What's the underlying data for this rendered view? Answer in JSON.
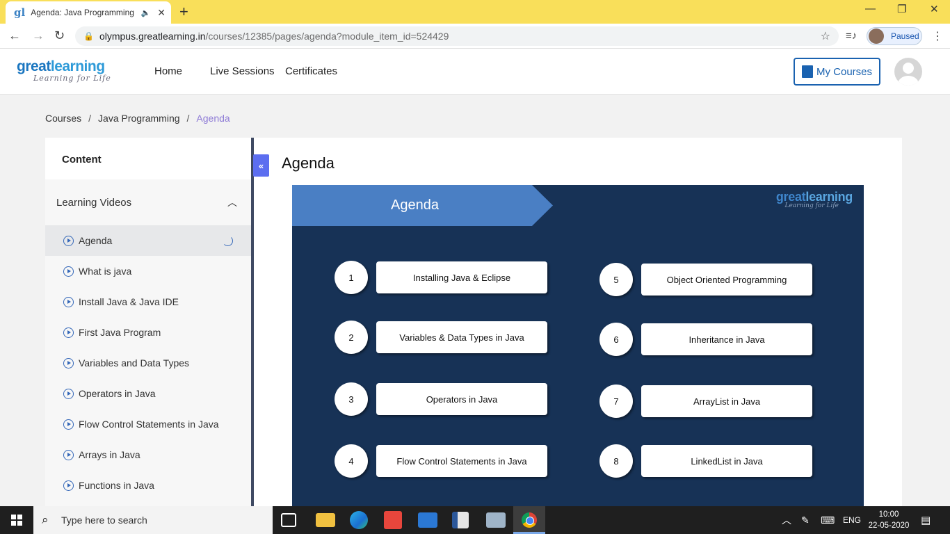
{
  "browser": {
    "tab_title": "Agenda: Java Programming",
    "favicon": "gl",
    "url_host": "olympus.greatlearning.in",
    "url_path": "/courses/12385/pages/agenda?module_item_id=524429",
    "profile_status": "Paused",
    "icons": [
      "back-icon",
      "forward-icon",
      "reload-icon",
      "lock-icon",
      "star-icon",
      "media-control-icon",
      "menu-kebab-icon"
    ]
  },
  "site": {
    "logo_main_1": "great",
    "logo_main_2": "learning",
    "logo_tagline": "Learning for Life",
    "nav": [
      "Home",
      "Live Sessions",
      "Certificates"
    ],
    "my_courses_label": "My Courses"
  },
  "breadcrumb": {
    "items": [
      "Courses",
      "Java Programming",
      "Agenda"
    ],
    "separator": "/"
  },
  "sidebar": {
    "header": "Content",
    "section_title": "Learning Videos",
    "items": [
      "Agenda",
      "What is java",
      "Install Java & Java IDE",
      "First Java Program",
      "Variables and Data Types",
      "Operators in Java",
      "Flow Control Statements in Java",
      "Arrays in Java",
      "Functions in Java"
    ],
    "active_index": 0
  },
  "main": {
    "title": "Agenda",
    "collapse_label": "«"
  },
  "slide": {
    "banner": "Agenda",
    "logo_main_1": "great",
    "logo_main_2": "learning",
    "logo_tagline": "Learning for Life",
    "left_items": [
      {
        "num": "1",
        "label": "Installing Java & Eclipse"
      },
      {
        "num": "2",
        "label": "Variables & Data Types in Java"
      },
      {
        "num": "3",
        "label": "Operators in Java"
      },
      {
        "num": "4",
        "label": "Flow Control Statements in Java"
      }
    ],
    "right_items": [
      {
        "num": "5",
        "label": "Object Oriented Programming"
      },
      {
        "num": "6",
        "label": "Inheritance in Java"
      },
      {
        "num": "7",
        "label": "ArrayList in Java"
      },
      {
        "num": "8",
        "label": "LinkedList in Java"
      }
    ],
    "colors": {
      "background": "#173256",
      "banner": "#4a7fc4"
    }
  },
  "taskbar": {
    "search_placeholder": "Type here to search",
    "language": "ENG",
    "time": "10:00",
    "date": "22-05-2020"
  }
}
